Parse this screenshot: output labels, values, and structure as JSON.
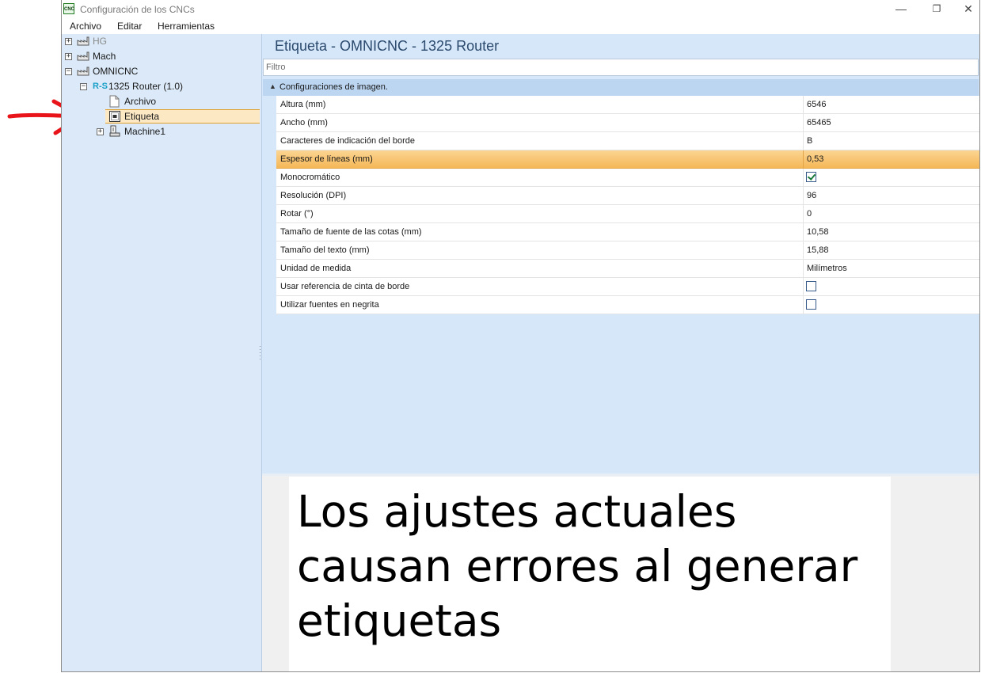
{
  "window": {
    "app_icon_text": "CNC",
    "title": "Configuración de los CNCs",
    "minimize_icon": "—",
    "restore_icon": "❐",
    "close_icon": "✕"
  },
  "menu": [
    "Archivo",
    "Editar",
    "Herramientas"
  ],
  "tree": {
    "nodes": [
      {
        "label": "HG",
        "expander": "+",
        "icon": "factory-icon",
        "dimmed": true
      },
      {
        "label": "Mach",
        "expander": "+",
        "icon": "factory-icon"
      },
      {
        "label": "OMNICNC",
        "expander": "−",
        "icon": "factory-icon"
      },
      {
        "label": "1325 Router (1.0)",
        "expander": "−",
        "icon_text": "R-S"
      },
      {
        "label": "Archivo",
        "icon": "document-icon"
      },
      {
        "label": "Etiqueta",
        "icon": "label-icon",
        "selected": true
      },
      {
        "label": "Machine1",
        "expander": "+",
        "icon": "machine-icon"
      }
    ]
  },
  "properties": {
    "title": "Etiqueta - OMNICNC - 1325 Router",
    "filter_placeholder": "Filtro",
    "category": "Configuraciones de imagen.",
    "rows": [
      {
        "name": "Altura (mm)",
        "value": "6546"
      },
      {
        "name": "Ancho (mm)",
        "value": "65465"
      },
      {
        "name": "Caracteres de indicación del borde",
        "value": "B"
      },
      {
        "name": "Espesor de líneas (mm)",
        "value": "0,53",
        "selected": true
      },
      {
        "name": "Monocromático",
        "checkbox": true,
        "checked": true
      },
      {
        "name": "Resolución (DPI)",
        "value": "96"
      },
      {
        "name": "Rotar (°)",
        "value": "0"
      },
      {
        "name": "Tamaño de fuente de las cotas (mm)",
        "value": "10,58"
      },
      {
        "name": "Tamaño del texto (mm)",
        "value": "15,88"
      },
      {
        "name": "Unidad de medida",
        "value": "Milímetros"
      },
      {
        "name": "Usar referencia de cinta de borde",
        "checkbox": true,
        "checked": false
      },
      {
        "name": "Utilizar fuentes en negrita",
        "checkbox": true,
        "checked": false
      }
    ]
  },
  "annotation": {
    "message": "Los ajustes actuales causan errores al generar etiquetas",
    "arrow_color": "#e8141a"
  },
  "colors": {
    "panel_bg": "#d6e7f9",
    "tree_bg": "#dbe9f8",
    "selection_orange": "#f5b757"
  }
}
